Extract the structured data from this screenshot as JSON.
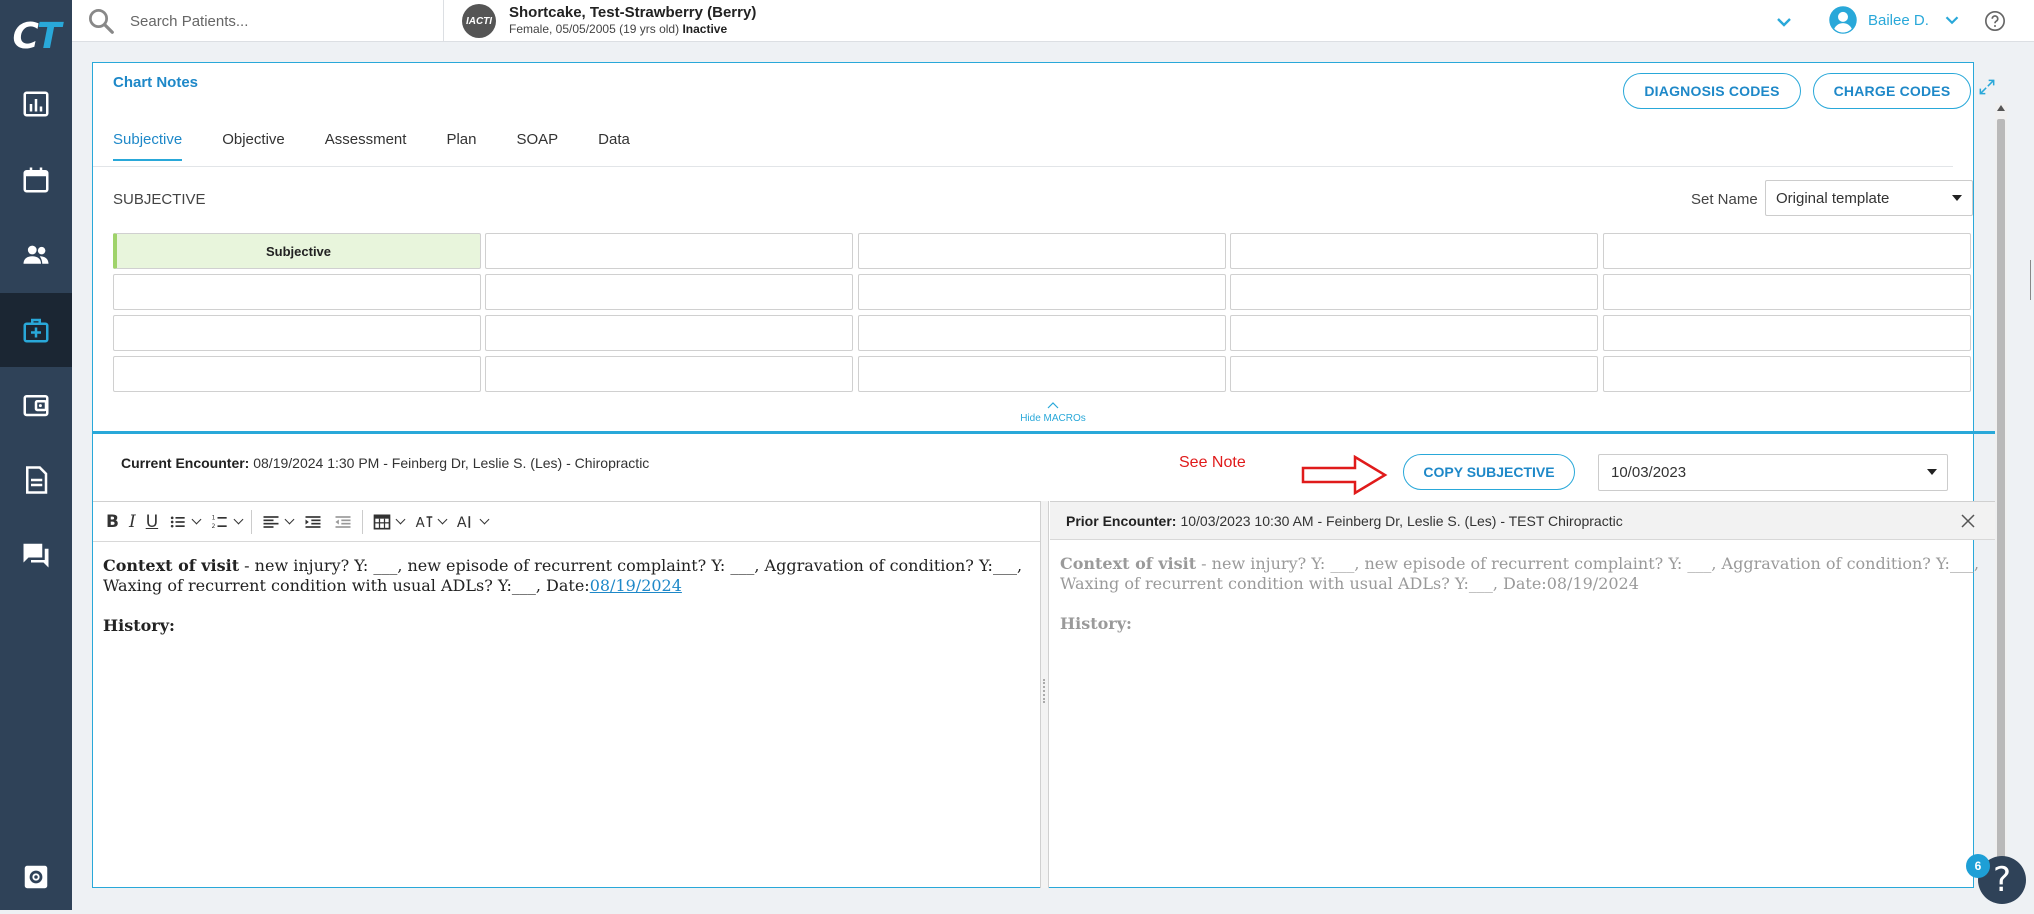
{
  "app": {
    "logo_c": "C",
    "logo_t": "T"
  },
  "sidebar": {
    "items": [
      {
        "name": "dashboard-icon"
      },
      {
        "name": "calendar-icon"
      },
      {
        "name": "patients-icon"
      },
      {
        "name": "medical-kit-icon"
      },
      {
        "name": "wallet-icon"
      },
      {
        "name": "document-icon"
      },
      {
        "name": "messages-icon"
      },
      {
        "name": "settings-icon"
      }
    ],
    "active_color": "#1b2633"
  },
  "search": {
    "placeholder": "Search Patients..."
  },
  "patient": {
    "avatar_text": "IACTI",
    "name": "Shortcake, Test-Strawberry (Berry)",
    "details": "Female, 05/05/2005 (19 yrs old)",
    "status": "Inactive"
  },
  "user": {
    "name": "Bailee D."
  },
  "panel": {
    "title": "Chart Notes",
    "diagnosis_codes": "DIAGNOSIS CODES",
    "charge_codes": "CHARGE CODES",
    "tabs": [
      "Subjective",
      "Objective",
      "Assessment",
      "Plan",
      "SOAP",
      "Data"
    ],
    "active_tab": "Subjective",
    "section_label": "SUBJECTIVE",
    "set_name_label": "Set Name",
    "set_name_value": "Original template",
    "macro_first": "Subjective",
    "hide_macros": "Hide MACROs"
  },
  "encounter": {
    "label": "Current Encounter:",
    "value": "08/19/2024 1:30 PM - Feinberg Dr, Leslie S. (Les) - Chiropractic",
    "see_note": "See Note",
    "copy_button": "COPY SUBJECTIVE",
    "prior_date": "10/03/2023"
  },
  "editor": {
    "context_label": "Context of visit",
    "context_text": " - new injury? Y: ___, new episode of recurrent complaint? Y: ___, Aggravation of condition? Y:___, Waxing of recurrent condition with usual ADLs? Y:___, Date:",
    "date_link": "08/19/2024",
    "history_label": "History:"
  },
  "prior": {
    "label": "Prior Encounter:",
    "value": "10/03/2023 10:30 AM - Feinberg Dr, Leslie S. (Les) - TEST Chiropractic",
    "context_label": "Context of visit",
    "context_text": " - new injury? Y: ___, new episode of recurrent complaint? Y: ___, Aggravation of condition? Y:___, Waxing of recurrent condition with usual ADLs? Y:___, Date:08/19/2024",
    "history_label": "History:"
  },
  "help": {
    "badge_count": "6",
    "fab_glyph": "?"
  },
  "colors": {
    "accent": "#29a8d9",
    "sidebar": "#2f4258",
    "note_red": "#e01b1b"
  }
}
